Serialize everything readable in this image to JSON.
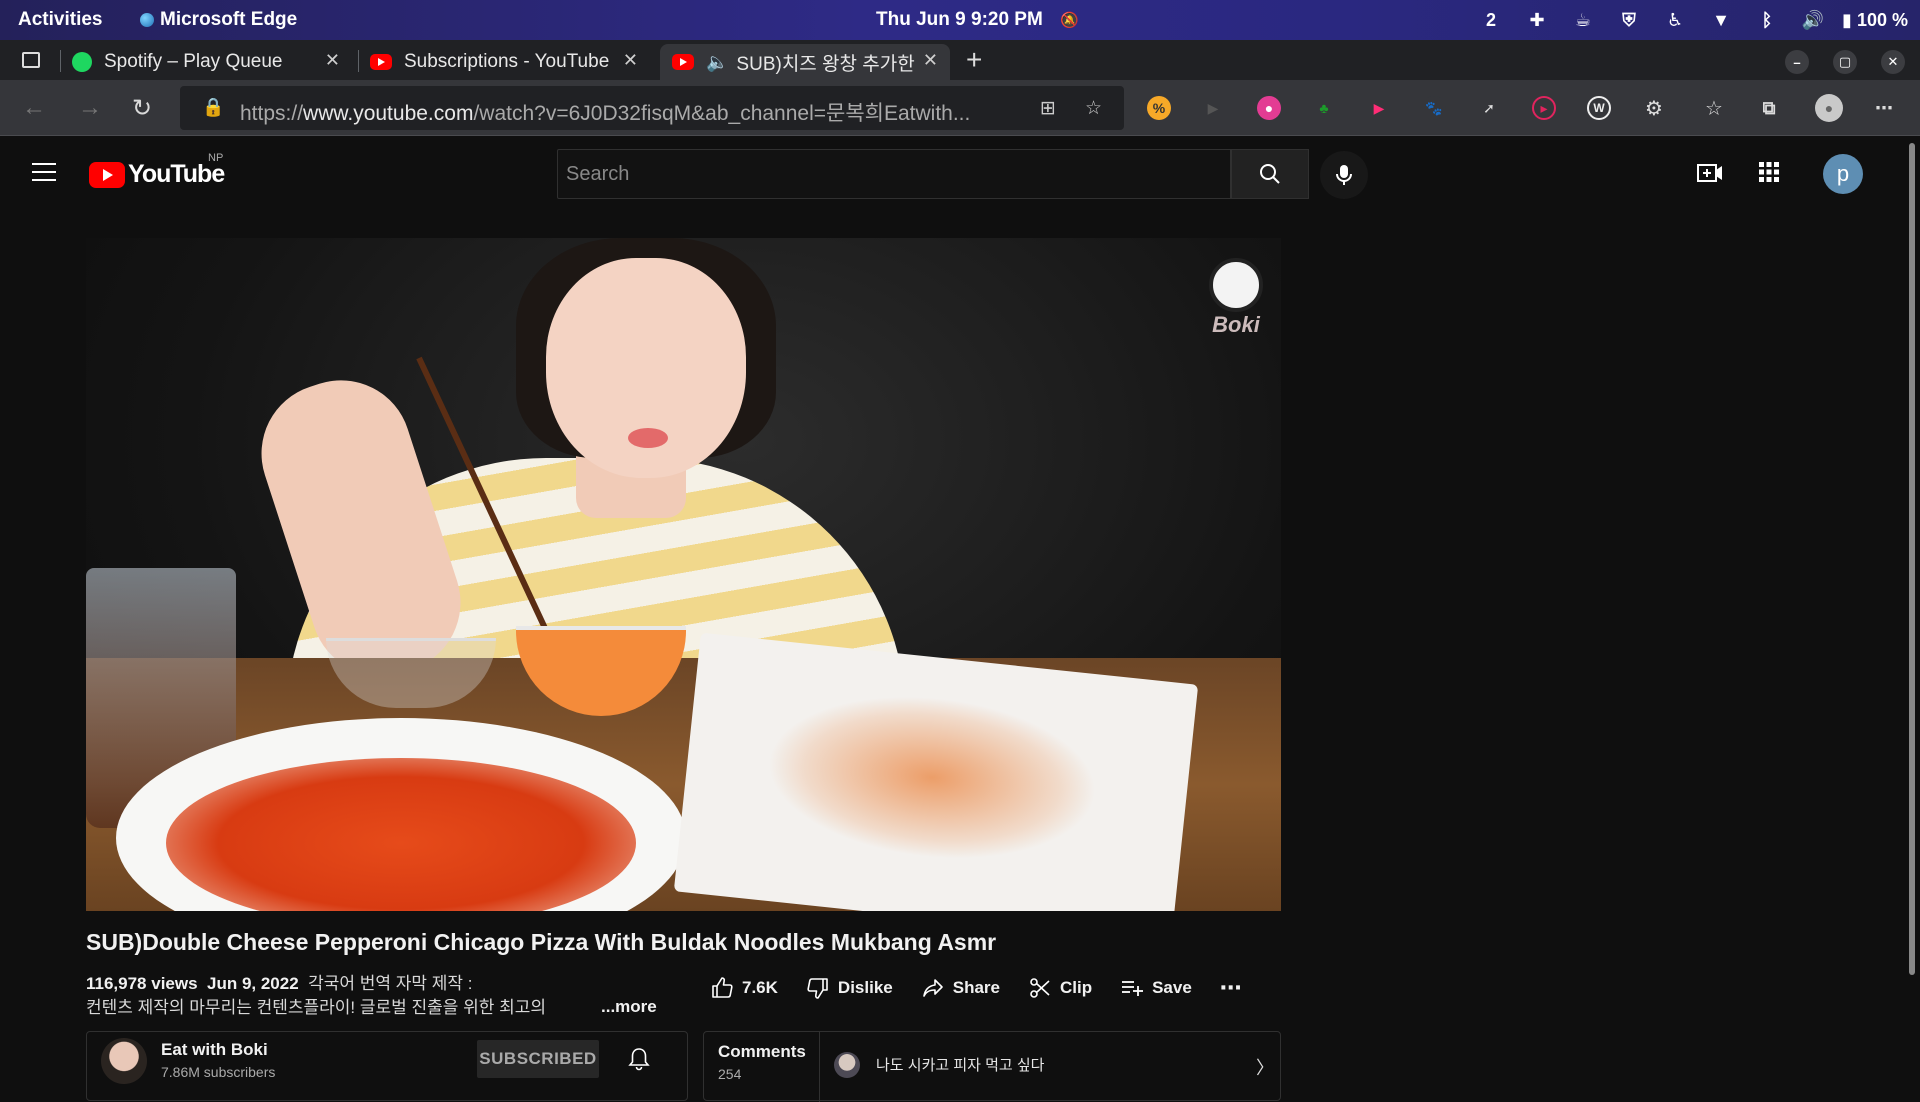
{
  "system_bar": {
    "activities": "Activities",
    "app_name": "Microsoft Edge",
    "clock": "Thu Jun 9   9:20 PM",
    "workspace": "2",
    "battery": "100 %"
  },
  "tabs": [
    {
      "label": "Spotify – Play Queue",
      "icon": "spotify-icon"
    },
    {
      "label": "Subscriptions - YouTube",
      "icon": "youtube-icon"
    },
    {
      "label": "SUB)치즈 왕창 추가한",
      "icon": "youtube-icon",
      "active": true
    }
  ],
  "address_bar": {
    "url_prefix": "https://",
    "url_host": "www.youtube.com",
    "url_rest": "/watch?v=6J0D32fisqM&ab_channel=문복희Eatwith..."
  },
  "youtube": {
    "logo_text": "YouTube",
    "region": "NP",
    "search_placeholder": "Search",
    "account_initial": "p"
  },
  "video": {
    "watermark": "Boki",
    "title": "SUB)Double Cheese Pepperoni Chicago Pizza With Buldak Noodles Mukbang Asmr",
    "views": "116,978 views",
    "date": "Jun 9, 2022",
    "desc_line1": "각국어 번역 자막 제작 :",
    "desc_line2": "컨텐츠 제작의 마무리는 컨텐츠플라이! 글로벌 진출을 위한 최고의",
    "more": "...more"
  },
  "actions": {
    "likes": "7.6K",
    "dislike": "Dislike",
    "share": "Share",
    "clip": "Clip",
    "save": "Save"
  },
  "channel": {
    "name": "Eat with Boki",
    "subscribers": "7.86M subscribers",
    "subscribe_state": "SUBSCRIBED"
  },
  "comments": {
    "label": "Comments",
    "count": "254",
    "preview": "나도 시카고 피자 먹고 싶다"
  },
  "colors": {
    "youtube_red": "#ff0000",
    "spotify_green": "#1ed760",
    "page_bg": "#0f0f0f"
  }
}
